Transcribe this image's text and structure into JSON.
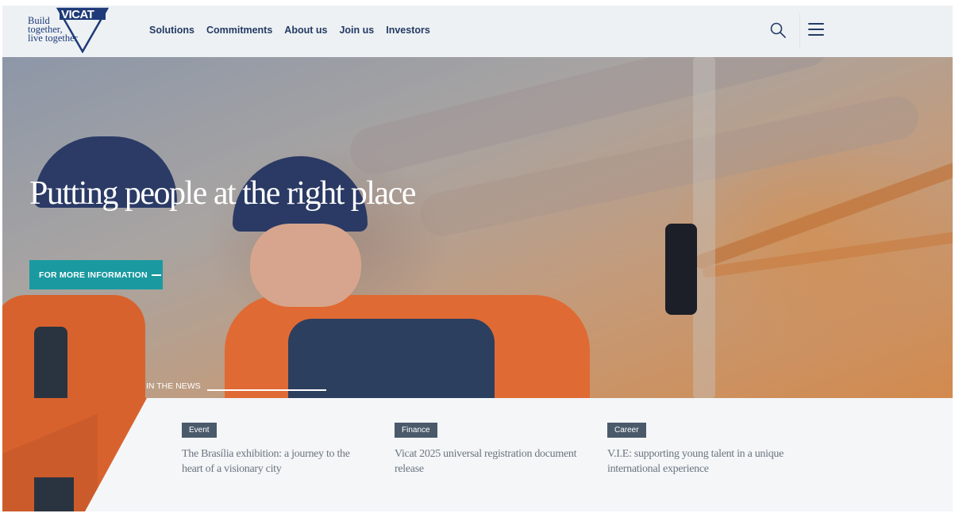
{
  "header": {
    "logo": {
      "tagline_lines": [
        "Build",
        "together,",
        "live together"
      ],
      "brand": "VICAT",
      "brand_color": "#1e3a78"
    },
    "nav": [
      {
        "label": "Solutions"
      },
      {
        "label": "Commitments"
      },
      {
        "label": "About us"
      },
      {
        "label": "Join us"
      },
      {
        "label": "Investors"
      }
    ],
    "search_icon": "search-icon",
    "menu_icon": "hamburger-menu-icon"
  },
  "hero": {
    "title": "Putting people at the right place",
    "cta_label": "FOR MORE INFORMATION",
    "cta_color": "#1a9aa0",
    "news_label": "IN THE NEWS"
  },
  "news": [
    {
      "tag": "Event",
      "title": "The Brasília exhibition: a journey to the heart of a visionary city"
    },
    {
      "tag": "Finance",
      "title": "Vicat 2025 universal registration document release"
    },
    {
      "tag": "Career",
      "title": "V.I.E: supporting young talent in a unique international experience"
    }
  ],
  "colors": {
    "nav_text": "#243a63",
    "tag_bg": "#4a5a6a",
    "news_text": "#6c7580"
  }
}
